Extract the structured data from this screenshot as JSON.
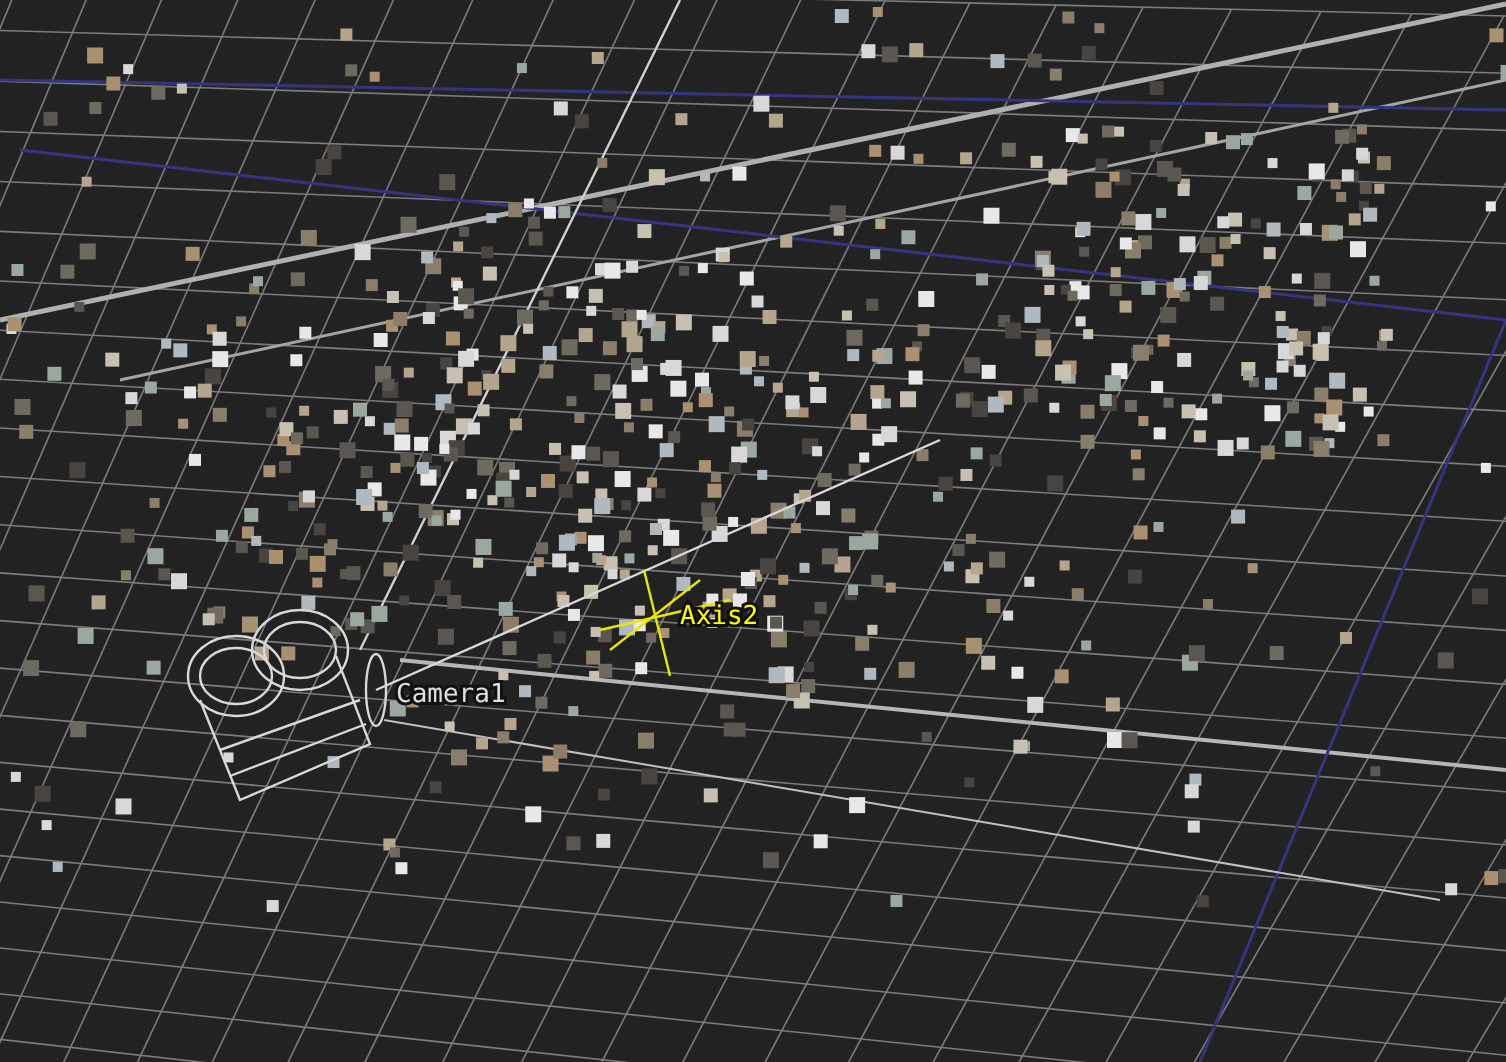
{
  "viewport": {
    "labels": [
      {
        "kind": "camera",
        "text": "Camera1"
      },
      {
        "kind": "axis",
        "text": "Axis2"
      }
    ]
  }
}
